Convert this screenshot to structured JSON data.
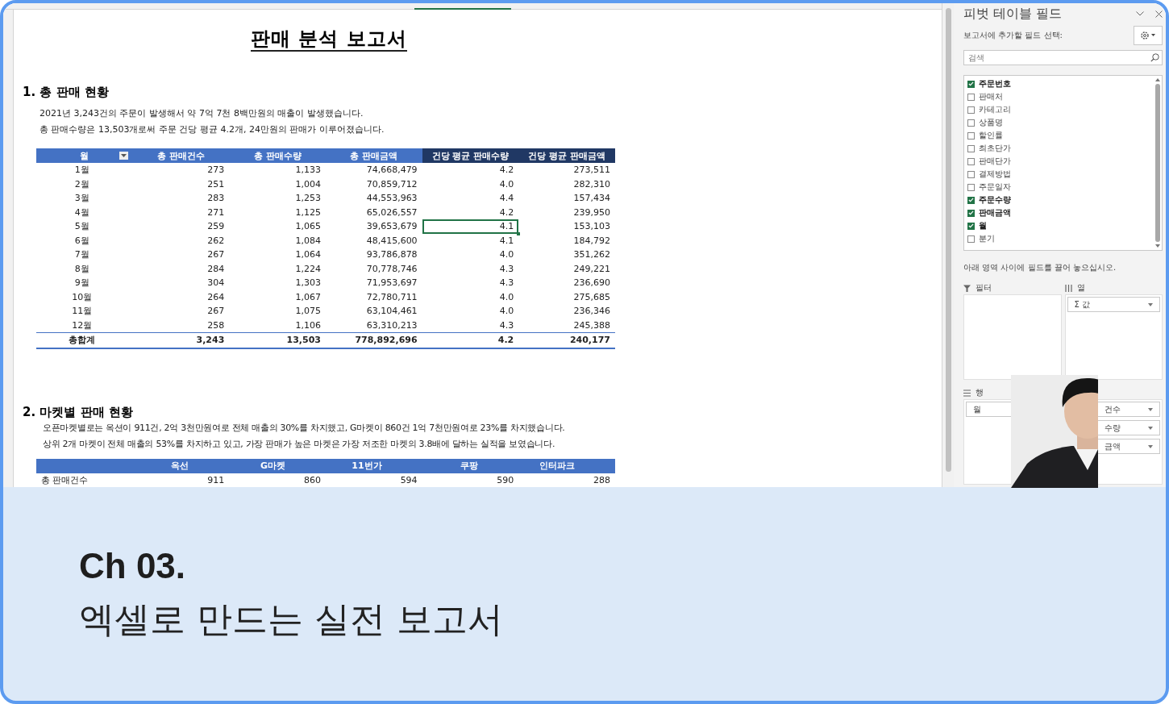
{
  "report": {
    "title": "판매 분석 보고서",
    "section_1": {
      "heading": "1. 총 판매 현황",
      "lines": [
        "2021년 3,243건의 주문이 발생해서 약 7억 7천 8백만원의 매출이 발생했습니다.",
        "총 판매수량은 13,503개로써 주문 건당 평균 4.2개, 24만원의 판매가 이루어졌습니다."
      ],
      "table": {
        "columns": [
          {
            "label": "월",
            "filter": true,
            "dark": false
          },
          {
            "label": "총 판매건수",
            "filter": false,
            "dark": false
          },
          {
            "label": "총 판매수량",
            "filter": false,
            "dark": false
          },
          {
            "label": "총 판매금액",
            "filter": false,
            "dark": false
          },
          {
            "label": "건당 평균 판매수량",
            "filter": false,
            "dark": true
          },
          {
            "label": "건당 평균 판매금액",
            "filter": false,
            "dark": true
          }
        ],
        "rows": [
          {
            "cells": [
              "1월",
              "273",
              "1,133",
              "74,668,479",
              "4.2",
              "273,511"
            ],
            "selected": [
              false,
              false,
              false,
              false,
              false,
              false
            ]
          },
          {
            "cells": [
              "2월",
              "251",
              "1,004",
              "70,859,712",
              "4.0",
              "282,310"
            ],
            "selected": [
              false,
              false,
              false,
              false,
              false,
              false
            ]
          },
          {
            "cells": [
              "3월",
              "283",
              "1,253",
              "44,553,963",
              "4.4",
              "157,434"
            ],
            "selected": [
              false,
              false,
              false,
              false,
              false,
              false
            ]
          },
          {
            "cells": [
              "4월",
              "271",
              "1,125",
              "65,026,557",
              "4.2",
              "239,950"
            ],
            "selected": [
              false,
              false,
              false,
              false,
              false,
              false
            ]
          },
          {
            "cells": [
              "5월",
              "259",
              "1,065",
              "39,653,679",
              "4.1",
              "153,103"
            ],
            "selected": [
              false,
              false,
              false,
              false,
              true,
              false
            ]
          },
          {
            "cells": [
              "6월",
              "262",
              "1,084",
              "48,415,600",
              "4.1",
              "184,792"
            ],
            "selected": [
              false,
              false,
              false,
              false,
              false,
              false
            ]
          },
          {
            "cells": [
              "7월",
              "267",
              "1,064",
              "93,786,878",
              "4.0",
              "351,262"
            ],
            "selected": [
              false,
              false,
              false,
              false,
              false,
              false
            ]
          },
          {
            "cells": [
              "8월",
              "284",
              "1,224",
              "70,778,746",
              "4.3",
              "249,221"
            ],
            "selected": [
              false,
              false,
              false,
              false,
              false,
              false
            ]
          },
          {
            "cells": [
              "9월",
              "304",
              "1,303",
              "71,953,697",
              "4.3",
              "236,690"
            ],
            "selected": [
              false,
              false,
              false,
              false,
              false,
              false
            ]
          },
          {
            "cells": [
              "10월",
              "264",
              "1,067",
              "72,780,711",
              "4.0",
              "275,685"
            ],
            "selected": [
              false,
              false,
              false,
              false,
              false,
              false
            ]
          },
          {
            "cells": [
              "11월",
              "267",
              "1,075",
              "63,104,461",
              "4.0",
              "236,346"
            ],
            "selected": [
              false,
              false,
              false,
              false,
              false,
              false
            ]
          },
          {
            "cells": [
              "12월",
              "258",
              "1,106",
              "63,310,213",
              "4.3",
              "245,388"
            ],
            "selected": [
              false,
              false,
              false,
              false,
              false,
              false
            ]
          }
        ],
        "total": [
          "총합계",
          "3,243",
          "13,503",
          "778,892,696",
          "4.2",
          "240,177"
        ]
      }
    },
    "section_2": {
      "heading": "2. 마켓별 판매 현황",
      "lines": [
        "오픈마켓별로는 옥션이 911건, 2억 3천만원여로 전체 매출의 30%를 차지했고, G마켓이 860건 1억 7천만원여로 23%를 차지했습니다.",
        "상위 2개 마켓이 전체 매출의 53%를 차지하고 있고, 가장 판매가 높은 마켓은 가장 저조한 마켓의 3.8배에 달하는 실적을 보였습니다."
      ],
      "table": {
        "columns": [
          "옥선",
          "G마켓",
          "11번가",
          "쿠팡",
          "인터파크"
        ],
        "rows": [
          {
            "label": "총 판매건수",
            "cells": [
              "911",
              "860",
              "594",
              "590",
              "288"
            ]
          }
        ]
      }
    }
  },
  "pivot_panel": {
    "title": "피벗 테이블 필드",
    "prompt": "보고서에 추가할 필드 선택:",
    "search": {
      "placeholder": "검색"
    },
    "fields": [
      {
        "label": "주문번호",
        "checked": true
      },
      {
        "label": "판매처",
        "checked": false
      },
      {
        "label": "카테고리",
        "checked": false
      },
      {
        "label": "상품명",
        "checked": false
      },
      {
        "label": "할인률",
        "checked": false
      },
      {
        "label": "최초단가",
        "checked": false
      },
      {
        "label": "판매단가",
        "checked": false
      },
      {
        "label": "결제방법",
        "checked": false
      },
      {
        "label": "주문일자",
        "checked": false
      },
      {
        "label": "주문수량",
        "checked": true
      },
      {
        "label": "판매금액",
        "checked": true
      },
      {
        "label": "월",
        "checked": true
      },
      {
        "label": "분기",
        "checked": false
      }
    ],
    "drag_hint": "아래 영역 사이에 필드를 끌어 놓으십시오.",
    "areas": {
      "filter": {
        "label": "필터"
      },
      "columns": {
        "label": "열",
        "items": [
          "Σ 값"
        ]
      },
      "rows": {
        "label": "행",
        "items": [
          "월"
        ]
      },
      "values": {
        "items": [
          "건수",
          "수량",
          "금액"
        ]
      }
    }
  },
  "caption": {
    "chapter": "Ch 03.",
    "subtitle": "엑셀로 만드는 실전 보고서"
  }
}
